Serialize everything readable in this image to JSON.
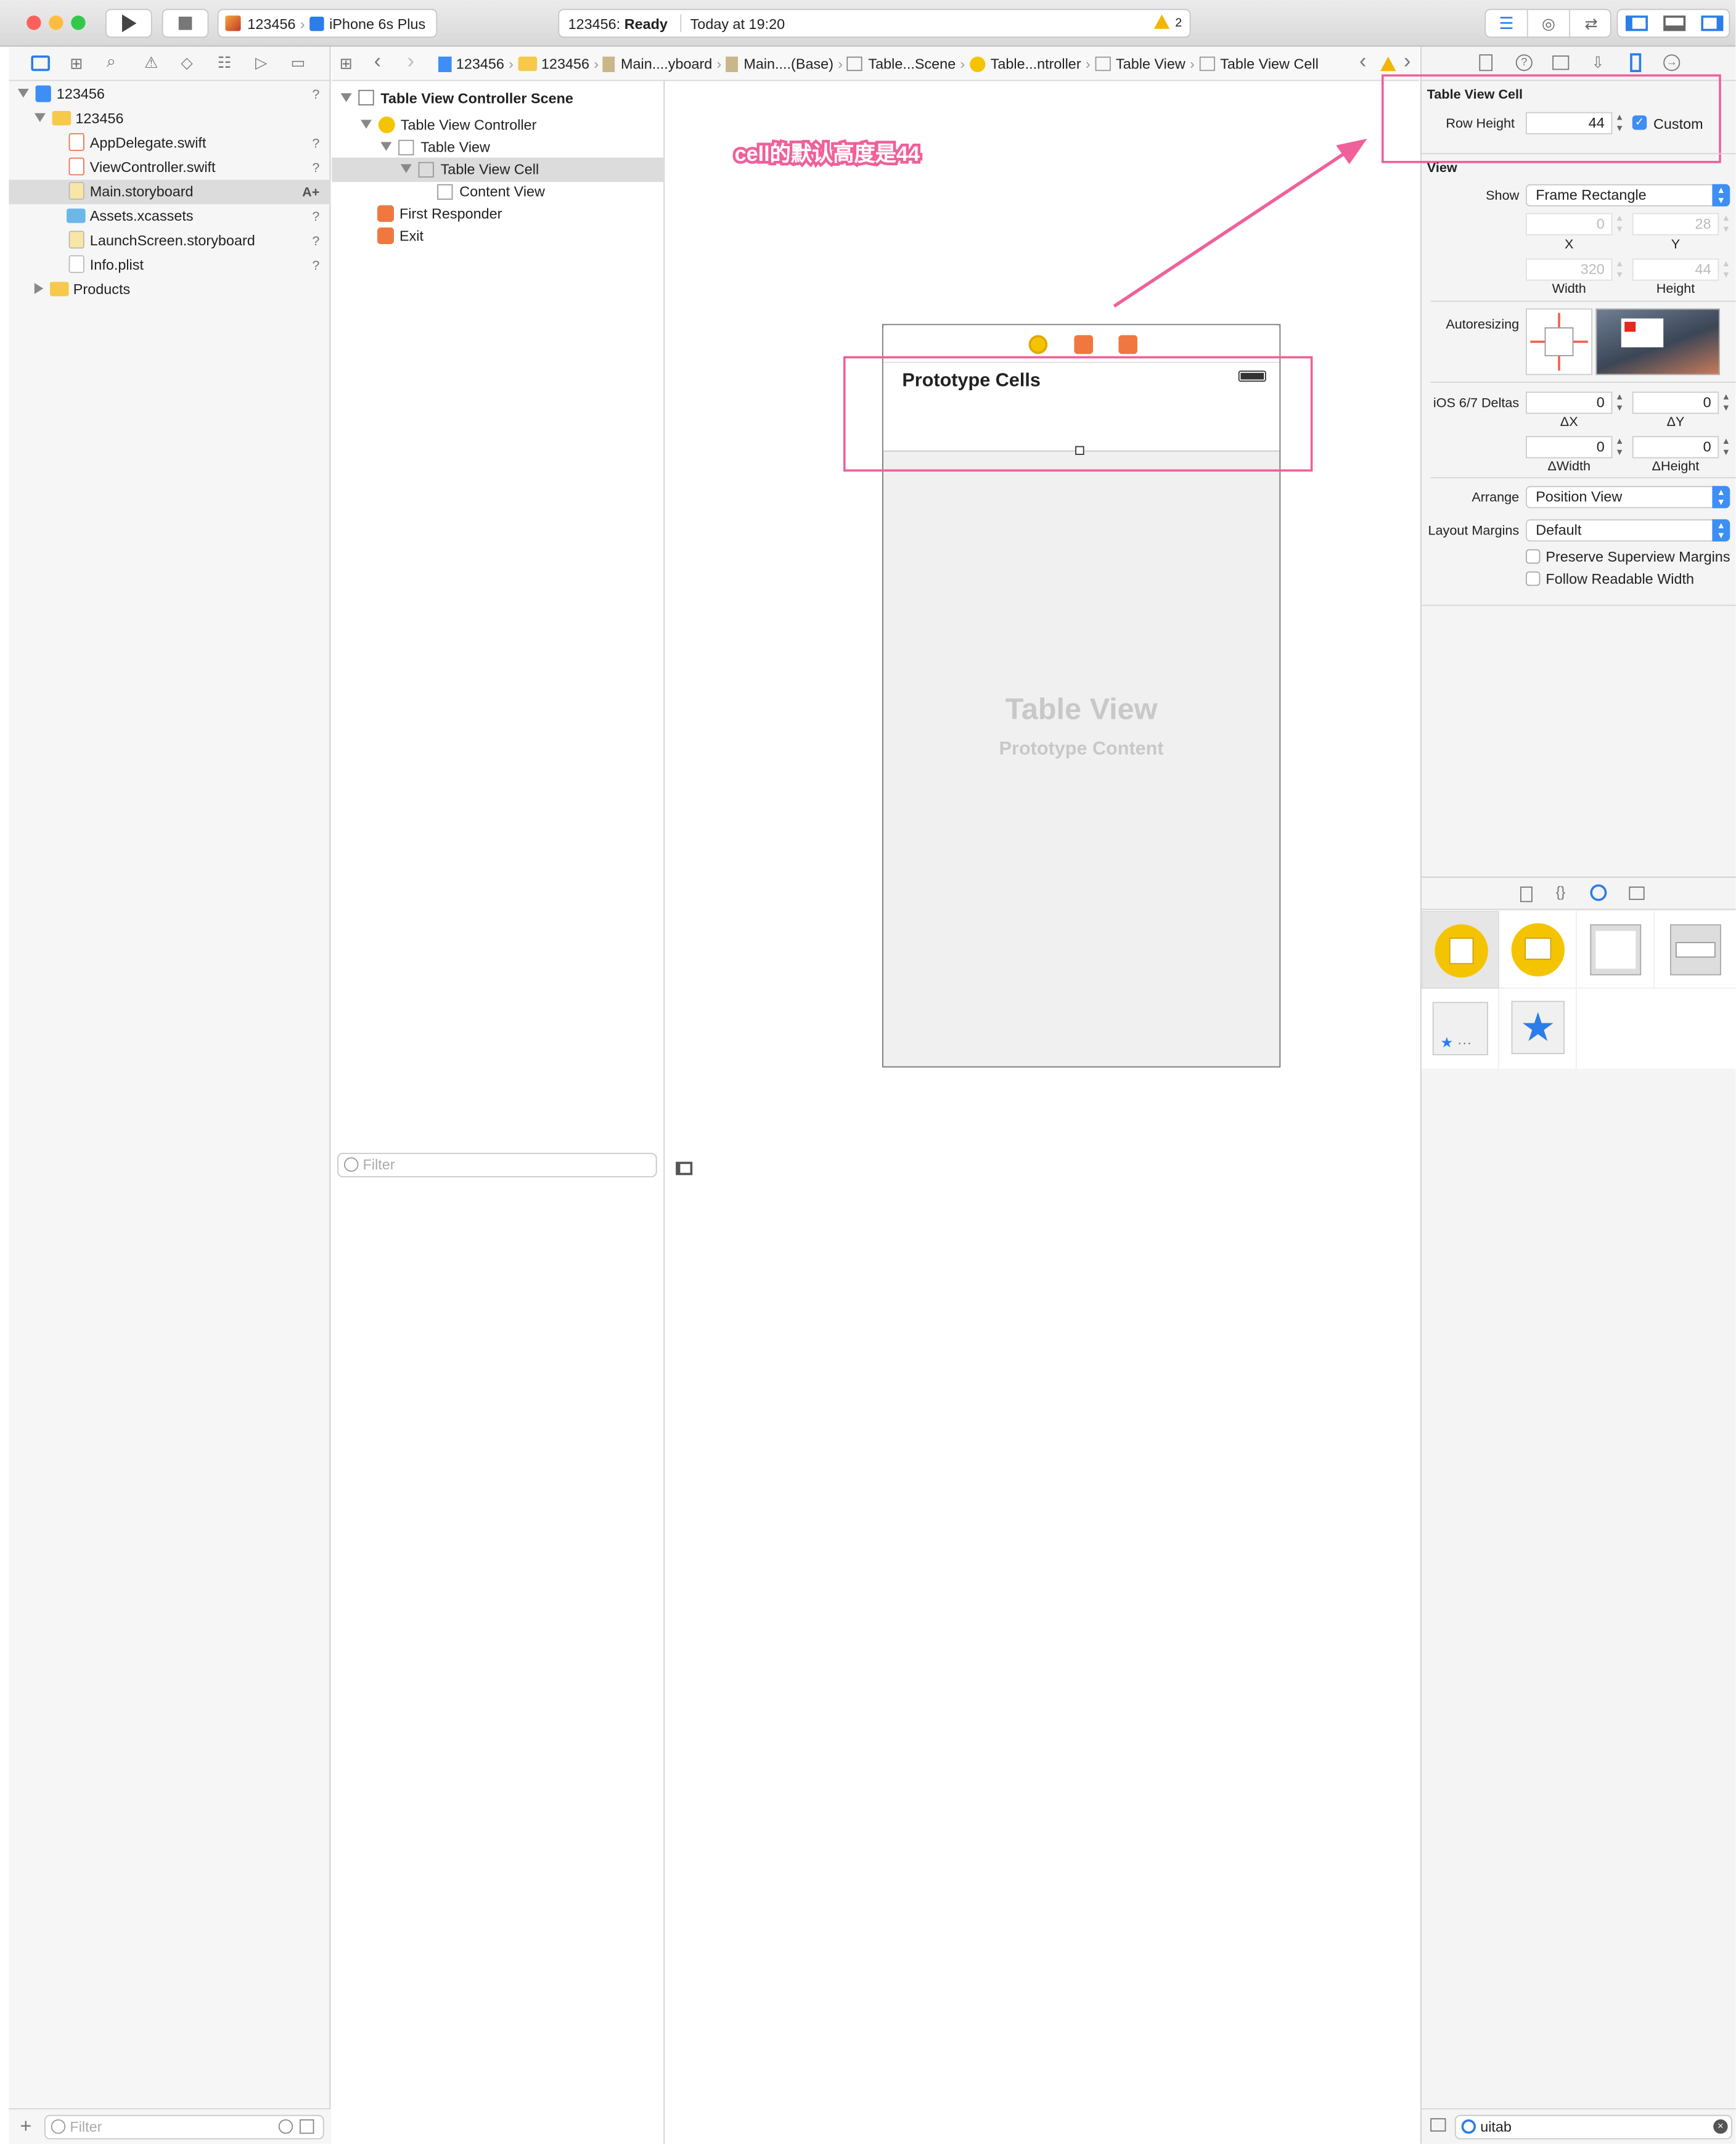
{
  "toolbar": {
    "scheme": "123456",
    "device": "iPhone 6s Plus",
    "status_project": "123456: ",
    "status_state": "Ready",
    "status_time": "Today at 19:20",
    "warning_count": "2"
  },
  "breadcrumb": [
    "123456",
    "123456",
    "Main....yboard",
    "Main....(Base)",
    "Table...Scene",
    "Table...ntroller",
    "Table View",
    "Table View Cell"
  ],
  "navigator": {
    "items": [
      {
        "label": "123456",
        "q": "?"
      },
      {
        "label": "123456",
        "q": ""
      },
      {
        "label": "AppDelegate.swift",
        "q": "?"
      },
      {
        "label": "ViewController.swift",
        "q": "?"
      },
      {
        "label": "Main.storyboard",
        "q": "A+"
      },
      {
        "label": "Assets.xcassets",
        "q": "?"
      },
      {
        "label": "LaunchScreen.storyboard",
        "q": "?"
      },
      {
        "label": "Info.plist",
        "q": "?"
      },
      {
        "label": "Products",
        "q": ""
      }
    ],
    "filter_placeholder": "Filter"
  },
  "outline": {
    "items": [
      "Table View Controller Scene",
      "Table View Controller",
      "Table View",
      "Table View Cell",
      "Content View",
      "First Responder",
      "Exit"
    ],
    "filter_placeholder": "Filter"
  },
  "canvas": {
    "annotation": "cell的默认高度是44",
    "prototype_cells": "Prototype Cells",
    "table_view_title": "Table View",
    "table_view_subtitle": "Prototype Content"
  },
  "inspector": {
    "cell_section": "Table View Cell",
    "row_height_label": "Row Height",
    "row_height_value": "44",
    "custom_label": "Custom",
    "view_section": "View",
    "show_label": "Show",
    "show_value": "Frame Rectangle",
    "x_value": "0",
    "y_value": "28",
    "x_label": "X",
    "y_label": "Y",
    "width_value": "320",
    "height_value": "44",
    "width_label": "Width",
    "height_label": "Height",
    "autoresizing_label": "Autoresizing",
    "deltas_label": "iOS 6/7 Deltas",
    "dx_value": "0",
    "dy_value": "0",
    "dx_label": "ΔX",
    "dy_label": "ΔY",
    "dw_value": "0",
    "dh_value": "0",
    "dw_label": "ΔWidth",
    "dh_label": "ΔHeight",
    "arrange_label": "Arrange",
    "arrange_value": "Position View",
    "margins_label": "Layout Margins",
    "margins_value": "Default",
    "preserve_label": "Preserve Superview Margins",
    "readable_label": "Follow Readable Width"
  },
  "library": {
    "search_value": "uitab"
  },
  "colors": {
    "accent": "#3d8ef5",
    "annotation": "#f0609a",
    "selection": "#dcdcdc"
  }
}
